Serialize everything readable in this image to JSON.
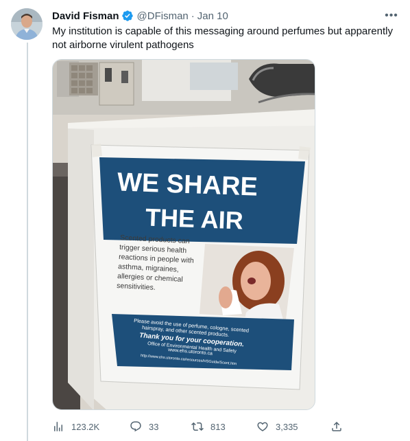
{
  "tweet": {
    "author_name": "David Fisman",
    "handle": "@DFisman",
    "separator": "·",
    "date": "Jan 10",
    "verified": true,
    "more_icon": "more-horizontal-icon",
    "text": "My institution is capable of this messaging around perfumes but apparently not airborne virulent pathogens"
  },
  "poster": {
    "headline_line1": "WE SHARE",
    "headline_line2": "THE AIR",
    "body_lines": [
      "Scented products can",
      "trigger serious health",
      "reactions in people with",
      "asthma, migraines,",
      "allergies or chemical",
      "sensitivities."
    ],
    "footer_lines": [
      "Please avoid the use of perfume, cologne, scented",
      "hairspray, and other scented products."
    ],
    "thanks": "Thank you for your cooperation.",
    "office": "Office of Environmental Health and Safety",
    "site": "www.ehs.utoronto.ca",
    "url": "http://www.ehs.utoronto.ca/resources/HSGuide/Scent.htm",
    "colors": {
      "blue": "#1d4f7a",
      "text_gray": "#3b3b3b"
    }
  },
  "metrics": {
    "views": "123.2K",
    "replies": "33",
    "retweets": "813",
    "likes": "3,335"
  },
  "icons": [
    "views-icon",
    "reply-icon",
    "retweet-icon",
    "like-icon",
    "share-icon",
    "verified-badge-icon"
  ],
  "colors": {
    "secondary_text": "#536471",
    "verified_blue": "#1d9bf0",
    "thread_line": "#cfd9de"
  }
}
